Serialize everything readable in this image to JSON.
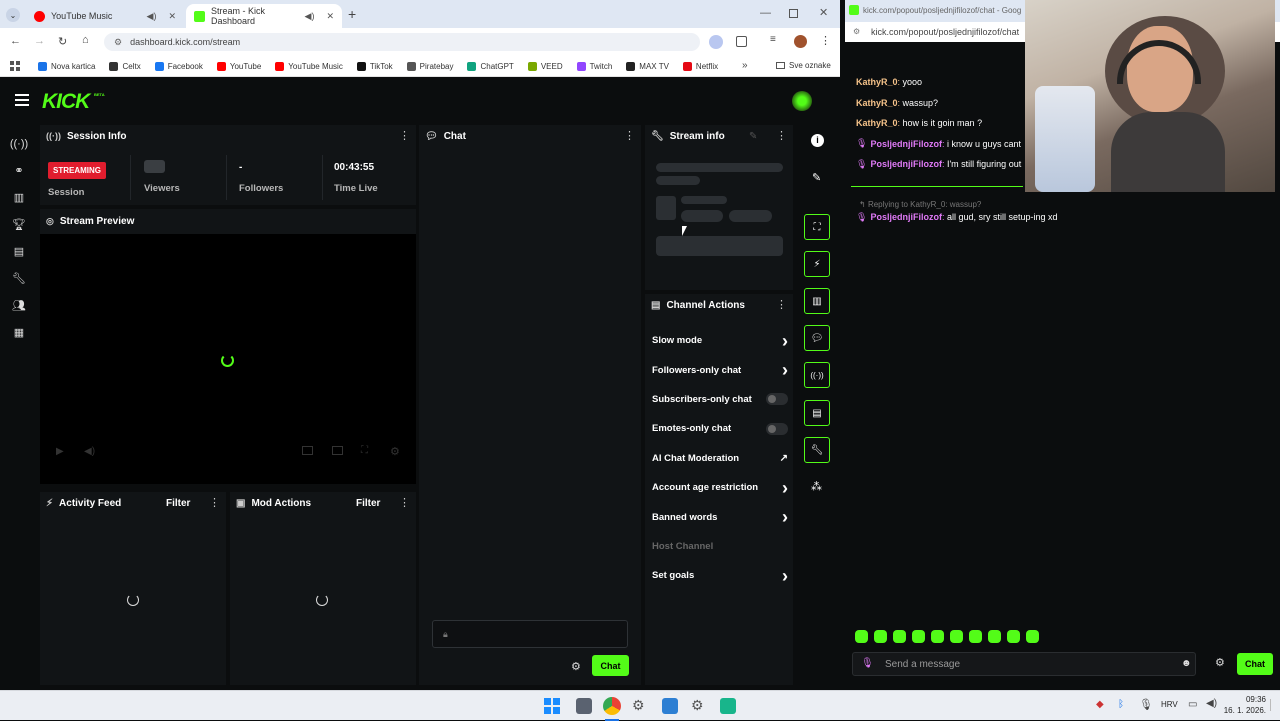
{
  "browser": {
    "tabs": [
      {
        "label": "YouTube Music"
      },
      {
        "label": "Stream - Kick Dashboard"
      }
    ],
    "new_tab": "+",
    "url": "dashboard.kick.com/stream",
    "bookmarks": [
      {
        "label": "Nova kartica",
        "color": "#1a73e8"
      },
      {
        "label": "Celtx",
        "color": "#333333"
      },
      {
        "label": "Facebook",
        "color": "#1877f2"
      },
      {
        "label": "YouTube",
        "color": "#ff0000"
      },
      {
        "label": "YouTube Music",
        "color": "#ff0000"
      },
      {
        "label": "TikTok",
        "color": "#111111"
      },
      {
        "label": "Piratebay",
        "color": "#555555"
      },
      {
        "label": "ChatGPT",
        "color": "#10a37f"
      },
      {
        "label": "VEED",
        "color": "#7aa800"
      },
      {
        "label": "Twitch",
        "color": "#9146ff"
      },
      {
        "label": "MAX TV",
        "color": "#222222"
      },
      {
        "label": "Netflix",
        "color": "#e50914"
      }
    ],
    "more": "»",
    "all_bookmarks": "Sve oznake"
  },
  "brand": {
    "name": "KICK",
    "tag": "BETA",
    "accent": "#53fc18"
  },
  "session": {
    "title": "Session Info",
    "badge": "STREAMING",
    "session_label": "Session",
    "viewers_label": "Viewers",
    "followers_value": "-",
    "followers_label": "Followers",
    "time_value": "00:43:55",
    "time_label": "Time Live"
  },
  "preview": {
    "title": "Stream Preview"
  },
  "activity": {
    "title": "Activity Feed",
    "filter": "Filter"
  },
  "mod": {
    "title": "Mod Actions",
    "filter": "Filter"
  },
  "chat": {
    "title": "Chat",
    "send": "Chat"
  },
  "stream_info": {
    "title": "Stream info"
  },
  "channel_actions": {
    "title": "Channel Actions",
    "items": [
      {
        "label": "Slow mode",
        "control": "arrow"
      },
      {
        "label": "Followers-only chat",
        "control": "arrow"
      },
      {
        "label": "Subscribers-only chat",
        "control": "toggle",
        "on": false
      },
      {
        "label": "Emotes-only chat",
        "control": "toggle",
        "on": false
      },
      {
        "label": "AI Chat Moderation",
        "control": "external"
      },
      {
        "label": "Account age restriction",
        "control": "arrow"
      },
      {
        "label": "Banned words",
        "control": "arrow"
      },
      {
        "label": "Host Channel",
        "control": "disabled"
      },
      {
        "label": "Set goals",
        "control": "arrow"
      }
    ]
  },
  "popout": {
    "url": "kick.com/popout/posljednjifilozof/chat",
    "window_title": "kick.com/popout/posljednjifilozof/chat - Goog",
    "messages": [
      {
        "user": "KathyR_0",
        "text": "yooo",
        "color": "#f6c38a",
        "badge": false
      },
      {
        "user": "KathyR_0",
        "text": "wassup?",
        "color": "#f6c38a",
        "badge": false
      },
      {
        "user": "KathyR_0",
        "text": "how is it goin man ?",
        "color": "#f6c38a",
        "badge": false
      },
      {
        "user": "PosljednjiFilozof",
        "text": "i know u guys cant",
        "color": "#e07af7",
        "badge": true
      },
      {
        "user": "PosljednjiFilozof",
        "text": "I'm still figuring out",
        "color": "#e07af7",
        "badge": true
      }
    ],
    "reply_to": "Replying to KathyR_0: wassup?",
    "reply": {
      "user": "PosljednjiFilozof",
      "text": "all gud, sry still setup-ing xd"
    },
    "send_placeholder": "Send a message",
    "send_button": "Chat"
  },
  "taskbar": {
    "lang": "HRV",
    "time": "09:36",
    "date": "16. 1. 2026."
  }
}
